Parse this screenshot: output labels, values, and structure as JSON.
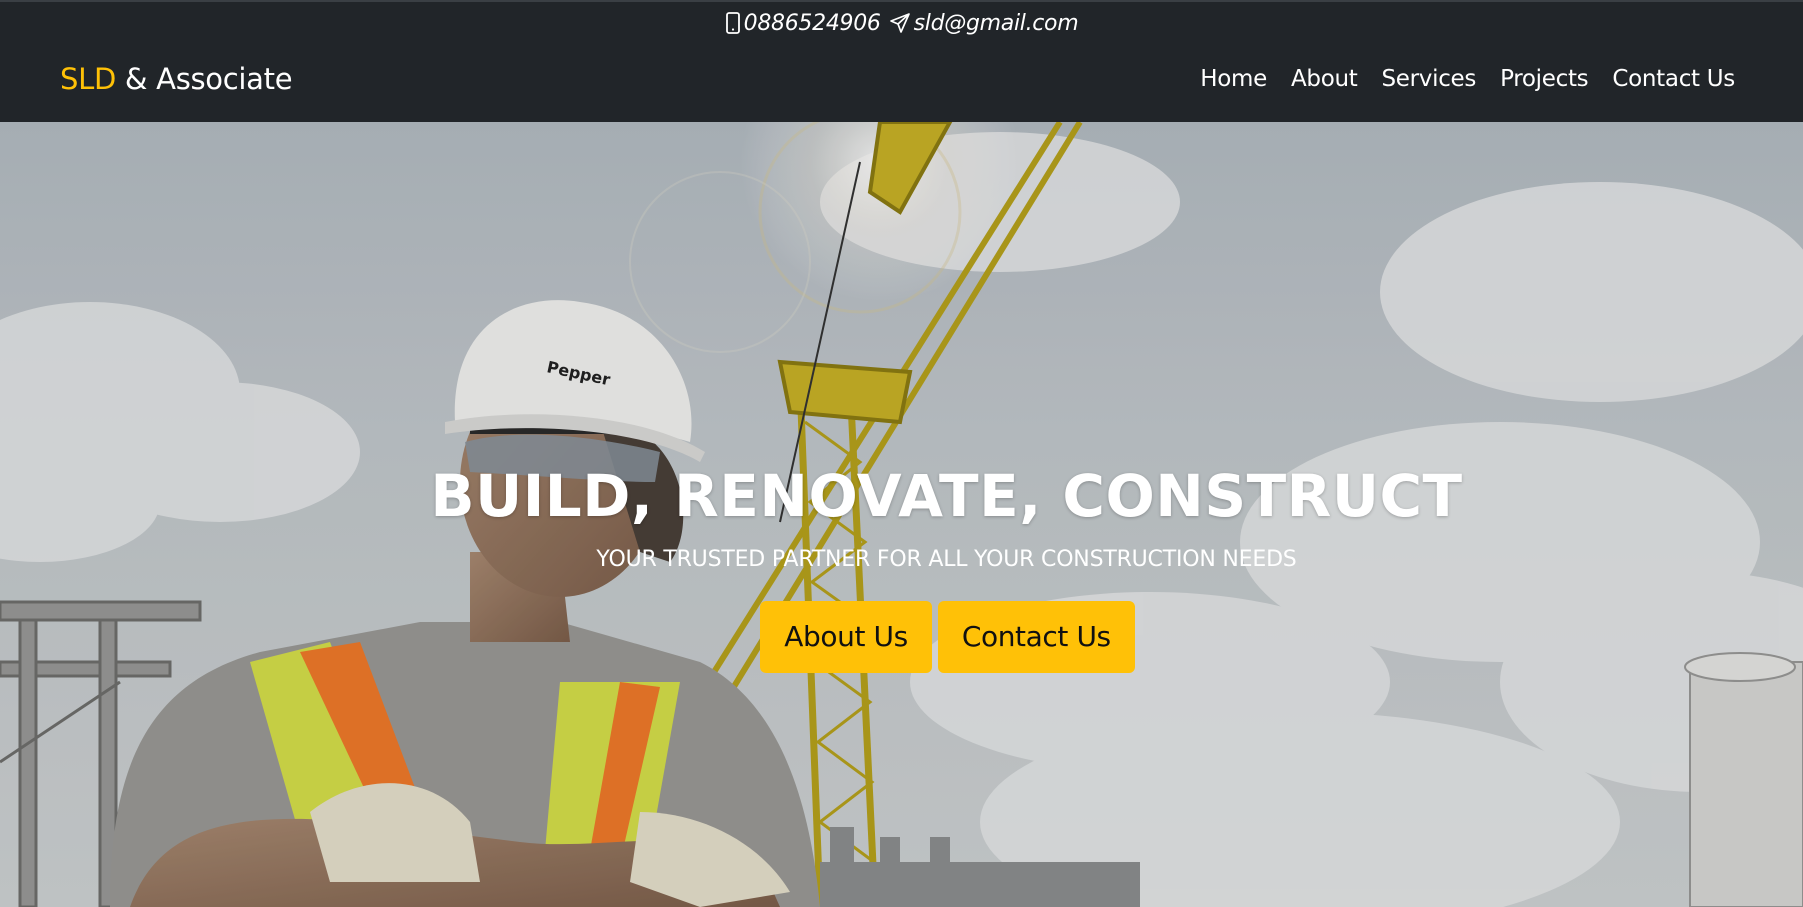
{
  "topbar": {
    "phone": "0886524906",
    "email": "sld@gmail.com"
  },
  "navbar": {
    "brand_accent": "SLD",
    "brand_rest": " & Associate",
    "links": [
      "Home",
      "About",
      "Services",
      "Projects",
      "Contact Us"
    ]
  },
  "hero": {
    "title": "BUILD, RENOVATE, CONSTRUCT",
    "subtitle": "YOUR TRUSTED PARTNER FOR ALL YOUR CONSTRUCTION NEEDS",
    "buttons": [
      "About Us",
      "Contact Us"
    ],
    "image_subject": "construction-worker-with-crane",
    "hard_hat_text": "Pepper"
  },
  "colors": {
    "accent": "#ffc107",
    "navbar_bg": "#212529",
    "text_light": "#ffffff"
  }
}
